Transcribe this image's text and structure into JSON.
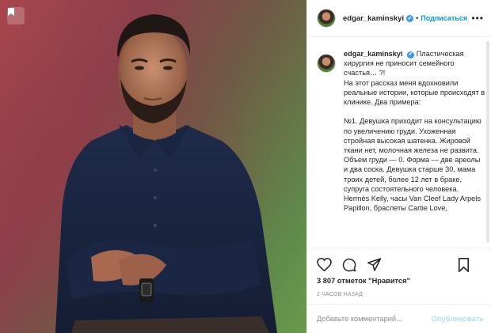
{
  "post": {
    "username": "edgar_kaminskyi",
    "follow_label": "Подписаться",
    "separator": "•",
    "more_label": "•••",
    "verified_mark": "✔",
    "caption": "Пластическая хирургия не приносит семейного счастья… ?!\nНа этот рассказ меня вдохновили реальные истории, которые происходят в клинике. Два примера:\n\n№1. Девушка приходит на консультацию по увеличению груди. Ухоженная стройная высокая шатенка. Жировой ткани нет, молочная железа не развита. Объем груди — 0. Форма — две ареолы и два соска. Девушка старше 30, мама троих детей, более 12 лет в браке, супруга состоятельного человека. Hermès Kelly, часы Van Cleef Lady Arpels Papillon, браслеты Cartie Love,",
    "likes_count": "3 807",
    "likes_suffix": "отметок",
    "likes_quote": "\"Нравится\"",
    "time_ago": "2 ЧАСОВ НАЗАД",
    "comment_placeholder": "Добавьте комментарий...",
    "publish_label": "Опубликовать"
  },
  "icons": {
    "like": "heart-icon",
    "comment": "comment-icon",
    "share": "share-icon",
    "save": "bookmark-icon",
    "photo_save": "bookmark-icon"
  },
  "colors": {
    "link_blue": "#0095f6",
    "verified_blue": "#3897f0",
    "publish_disabled": "#b2dffc",
    "muted": "#8e8e8e"
  }
}
